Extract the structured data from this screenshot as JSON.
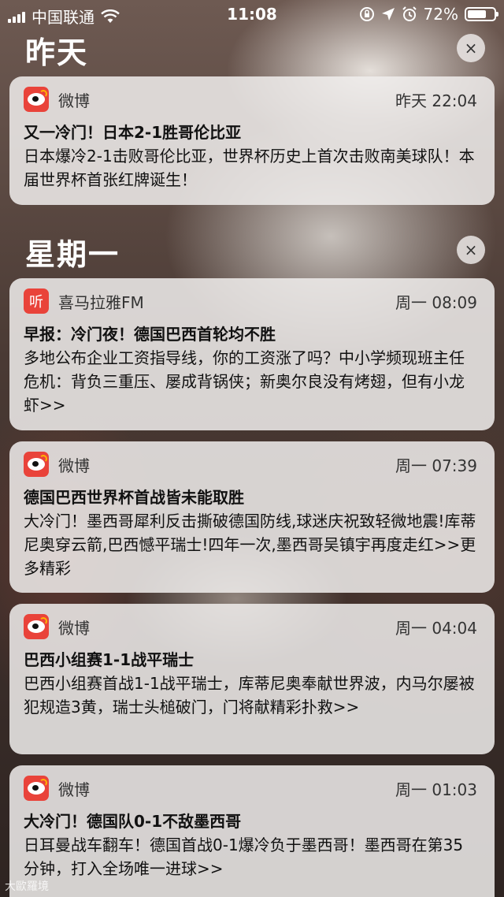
{
  "status_bar": {
    "carrier": "中国联通",
    "time": "11:08",
    "battery_percent": "72%",
    "battery_level": 0.72
  },
  "sections": [
    {
      "title": "昨天",
      "clear_icon": "×"
    },
    {
      "title": "星期一",
      "clear_icon": "×"
    }
  ],
  "notifications": [
    {
      "app": "微博",
      "icon": "weibo-icon",
      "time": "昨天 22:04",
      "title": "又一冷门！日本2-1胜哥伦比亚",
      "body": "日本爆冷2-1击败哥伦比亚，世界杯历史上首次击败南美球队！本届世界杯首张红牌诞生！"
    },
    {
      "app": "喜马拉雅FM",
      "icon": "ximalaya-icon",
      "icon_glyph": "听",
      "time": "周一 08:09",
      "title": "早报：冷门夜！德国巴西首轮均不胜",
      "body": "多地公布企业工资指导线，你的工资涨了吗？中小学频现班主任危机：背负三重压、屡成背锅侠；新奥尔良没有烤翅，但有小龙虾>>"
    },
    {
      "app": "微博",
      "icon": "weibo-icon",
      "time": "周一 07:39",
      "title": "德国巴西世界杯首战皆未能取胜",
      "body": "大冷门！墨西哥犀利反击撕破德国防线,球迷庆祝致轻微地震!库蒂尼奥穿云箭,巴西憾平瑞士!四年一次,墨西哥吴镇宇再度走红>>更多精彩"
    },
    {
      "app": "微博",
      "icon": "weibo-icon",
      "time": "周一 04:04",
      "title": "巴西小组赛1-1战平瑞士",
      "body": "巴西小组赛首战1-1战平瑞士，库蒂尼奥奉献世界波，内马尔屡被犯规造3黄，瑞士头槌破门，门将献精彩扑救>>"
    },
    {
      "app": "微博",
      "icon": "weibo-icon",
      "time": "周一 01:03",
      "title": "大冷门！德国队0-1不敌墨西哥",
      "body": "日耳曼战车翻车！德国首战0-1爆冷负于墨西哥！墨西哥在第35分钟，打入全场唯一进球>>"
    }
  ],
  "watermark": "大歐羅境"
}
